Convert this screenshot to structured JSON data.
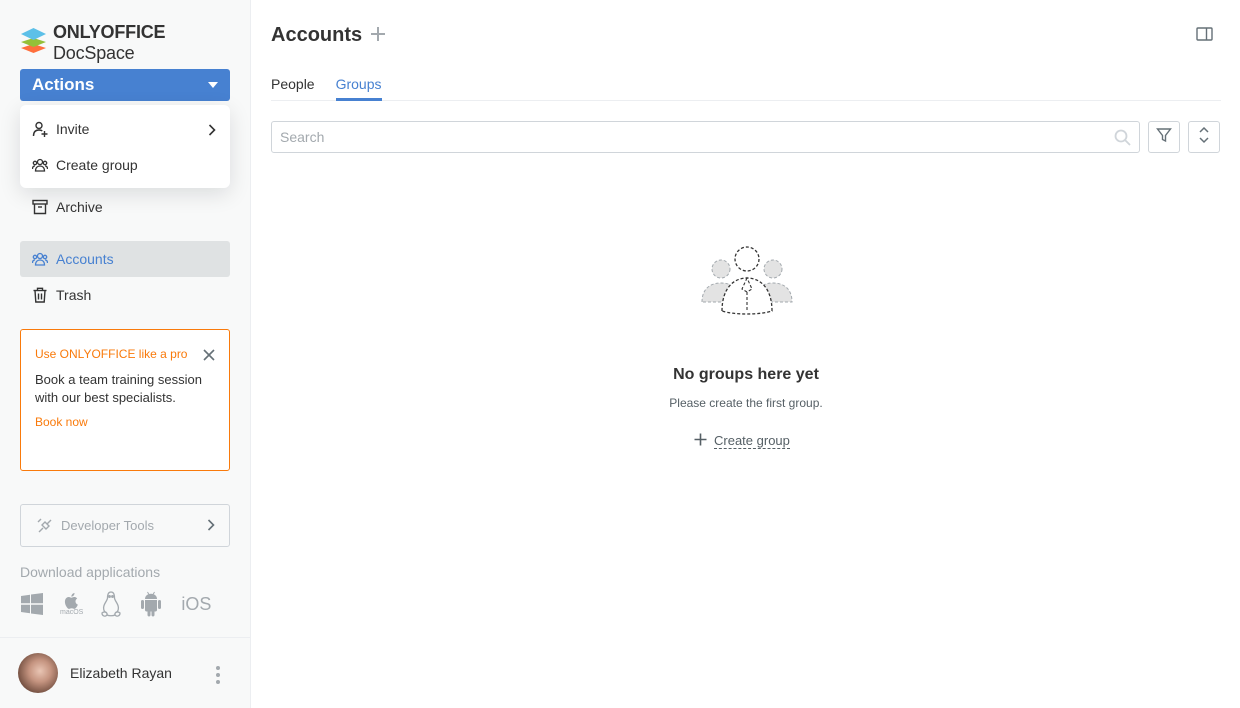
{
  "logo": {
    "brand": "ONLYOFFICE",
    "product": "DocSpace"
  },
  "sidebar": {
    "actions_label": "Actions",
    "dropdown": [
      {
        "label": "Invite",
        "icon": "invite-user-icon",
        "has_submenu": true
      },
      {
        "label": "Create group",
        "icon": "group-icon",
        "has_submenu": false
      }
    ],
    "items": [
      {
        "label": "Archive",
        "icon": "archive-icon",
        "active": false
      },
      {
        "label": "Accounts",
        "icon": "accounts-icon",
        "active": true
      },
      {
        "label": "Trash",
        "icon": "trash-icon",
        "active": false
      }
    ],
    "promo": {
      "title": "Use ONLYOFFICE like a pro",
      "body": "Book a team training session with our best specialists.",
      "link": "Book now"
    },
    "developer_tools": "Developer Tools",
    "download_label": "Download applications",
    "apps": [
      "windows-icon",
      "macos-icon",
      "linux-icon",
      "android-icon",
      "ios-icon"
    ],
    "apps_text": {
      "macos": "macOS",
      "ios": "iOS"
    },
    "user": {
      "name": "Elizabeth Rayan"
    }
  },
  "main": {
    "title": "Accounts",
    "tabs": [
      {
        "label": "People",
        "active": false
      },
      {
        "label": "Groups",
        "active": true
      }
    ],
    "search": {
      "placeholder": "Search",
      "value": ""
    },
    "empty": {
      "title": "No groups here yet",
      "subtitle": "Please create the first group.",
      "action": "Create group"
    }
  },
  "colors": {
    "accent": "#4781d1",
    "promo": "#f97a0b",
    "sidebar_bg": "#f8f9f9",
    "muted": "#a3a9ae"
  }
}
